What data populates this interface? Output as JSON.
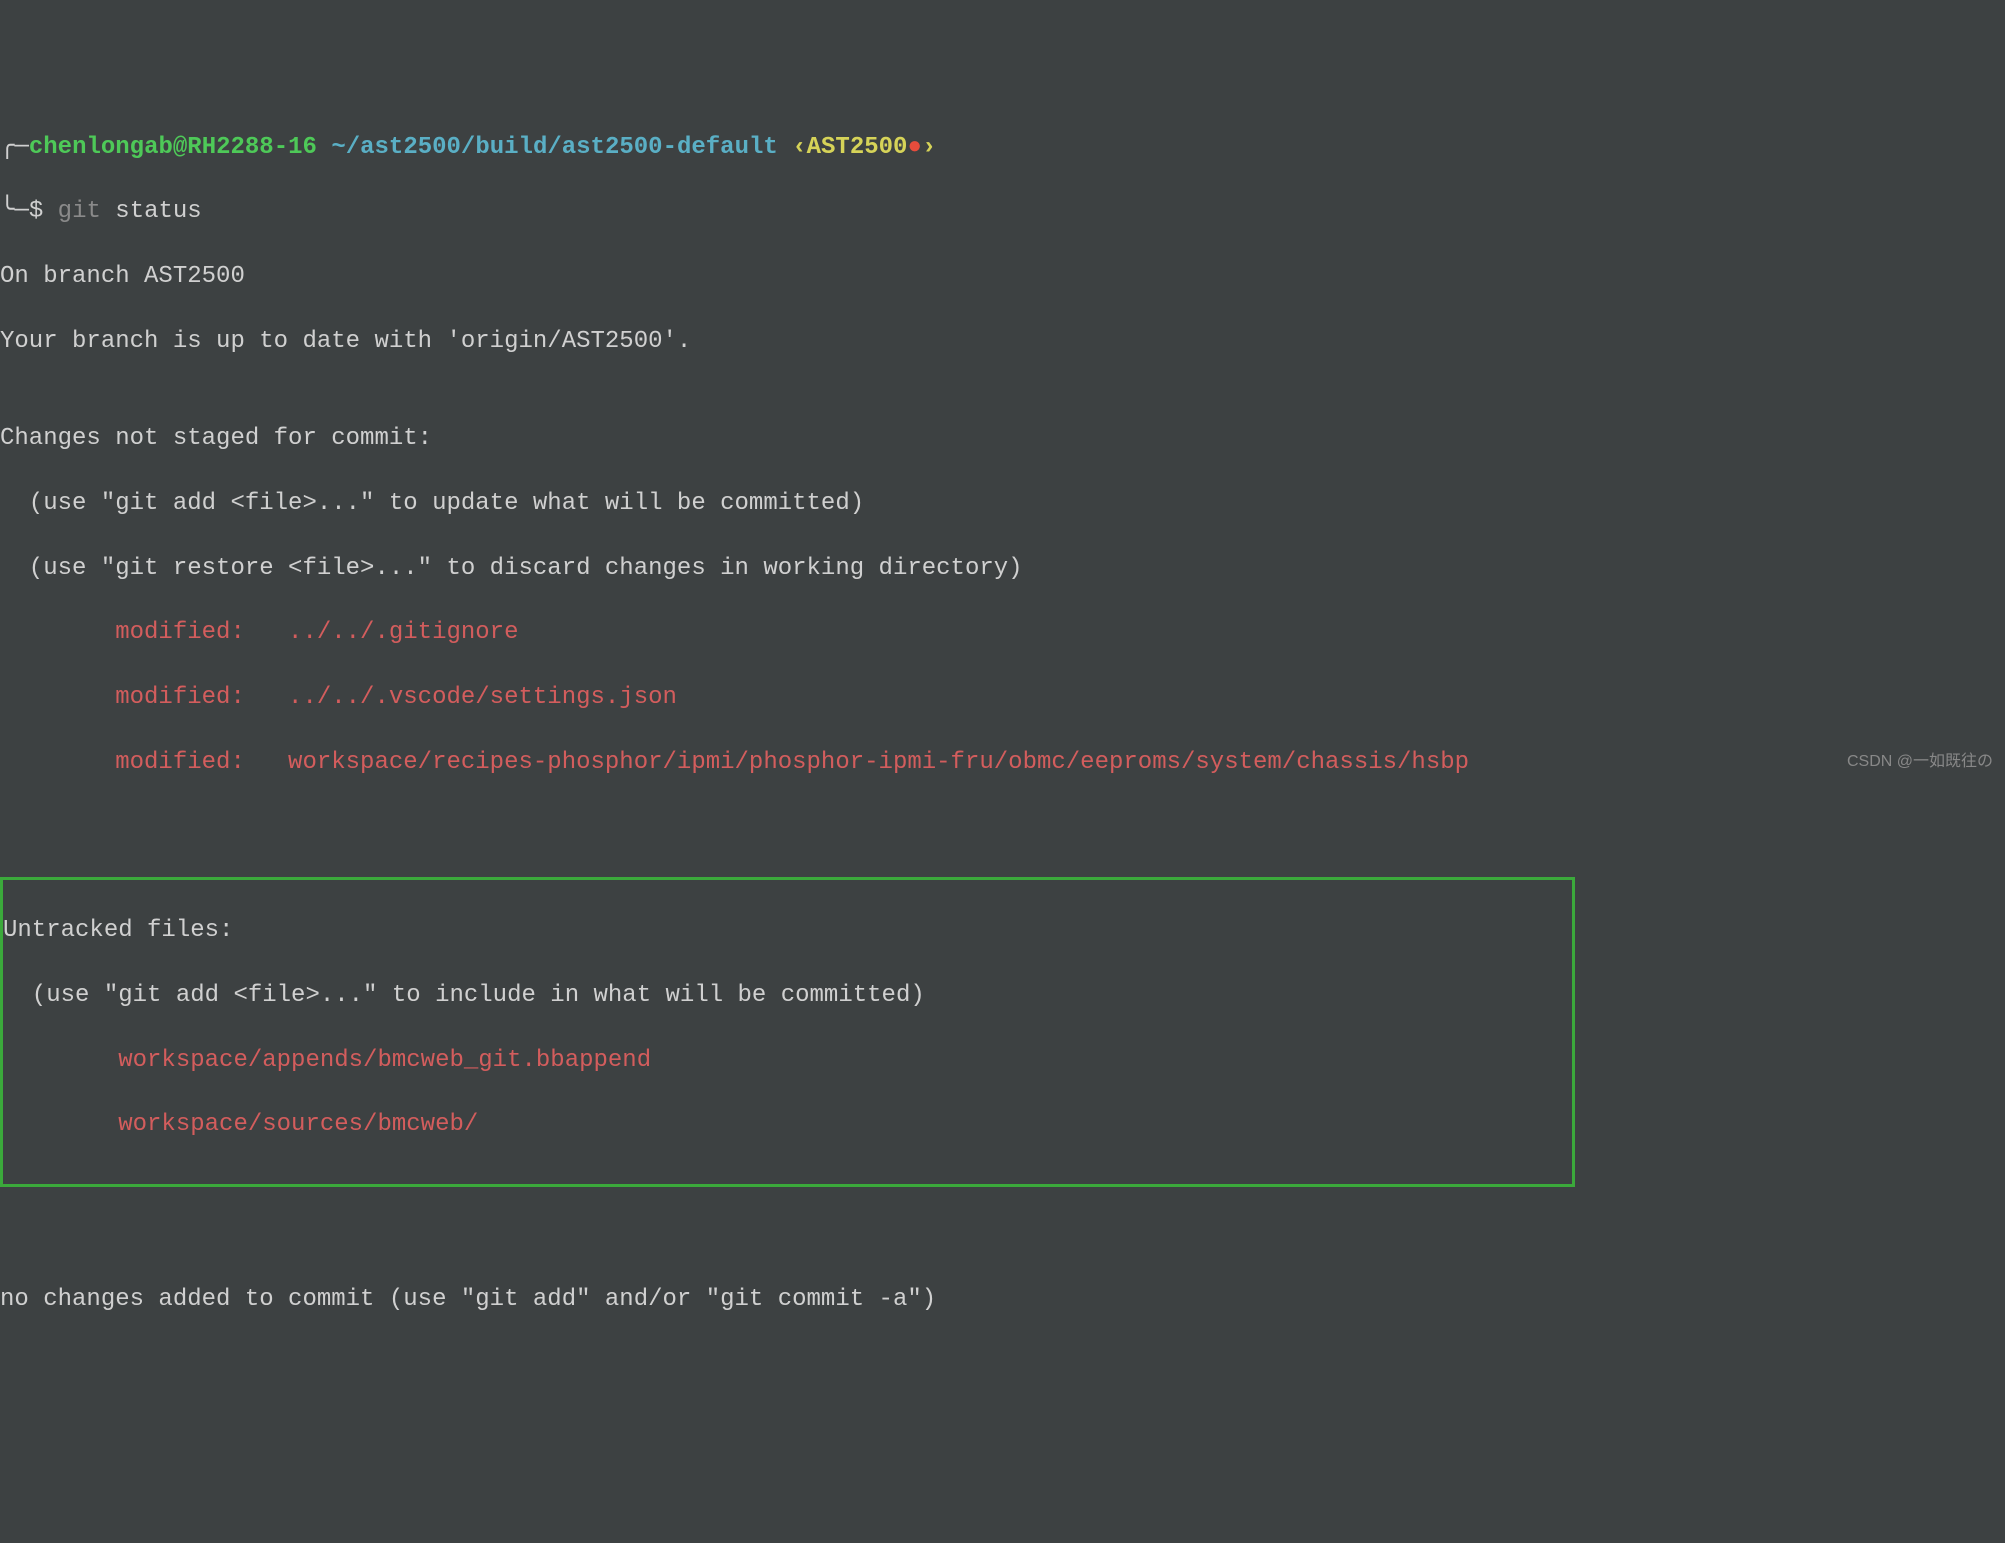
{
  "prompt": {
    "top_left": "╭─",
    "user_host": "chenlongab@RH2288-16",
    "path": "~/ast2500/build/ast2500-default",
    "branch_open": "‹",
    "branch": "AST2500",
    "branch_close": "›",
    "bottom_left": "╰─",
    "dollar": "$",
    "command_git": "git",
    "command_args": "status"
  },
  "output": {
    "line1": "On branch AST2500",
    "line2": "Your branch is up to date with 'origin/AST2500'.",
    "blank1": "",
    "changes_header": "Changes not staged for commit:",
    "changes_hint1": "  (use \"git add <file>...\" to update what will be committed)",
    "changes_hint2": "  (use \"git restore <file>...\" to discard changes in working directory)",
    "modified1": "        modified:   ../../.gitignore",
    "modified2": "        modified:   ../../.vscode/settings.json",
    "modified3": "        modified:   workspace/recipes-phosphor/ipmi/phosphor-ipmi-fru/obmc/eeproms/system/chassis/hsbp",
    "untracked_header": "Untracked files:",
    "untracked_hint": "  (use \"git add <file>...\" to include in what will be committed)",
    "untracked1": "        workspace/appends/bmcweb_git.bbappend",
    "untracked2": "        workspace/sources/bmcweb/",
    "final": "no changes added to commit (use \"git add\" and/or \"git commit -a\")"
  },
  "watermark": "CSDN @一如既往の"
}
